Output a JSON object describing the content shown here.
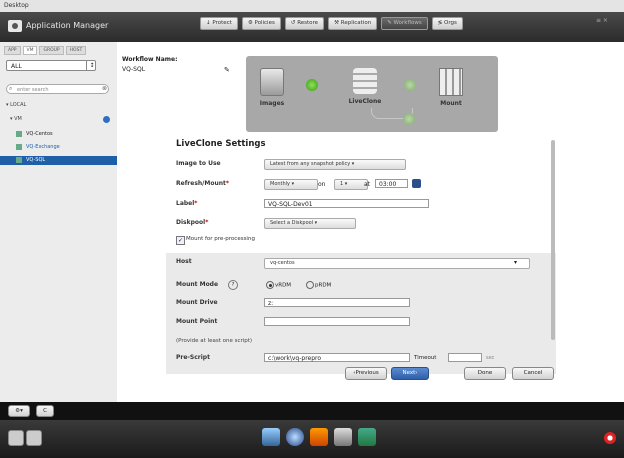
{
  "desktop": {
    "title": "Desktop"
  },
  "app": {
    "title": "Application Manager"
  },
  "topnav": [
    {
      "label": "↓ Protect",
      "active": false
    },
    {
      "label": "⚙ Policies",
      "active": false
    },
    {
      "label": "↺ Restore",
      "active": false
    },
    {
      "label": "⚒ Replication",
      "active": false
    },
    {
      "label": "✎ Workflows",
      "active": true
    },
    {
      "label": "≶ Orgs",
      "active": false
    }
  ],
  "window_controls": "≡ ×",
  "sidebar": {
    "tabs": [
      "APP",
      "VM",
      "GROUP",
      "HOST"
    ],
    "filter_value": "ALL",
    "filter_arrow": "↕",
    "search_placeholder": "enter search",
    "search_icon": "⌕",
    "search_clear": "⊗",
    "tree_local": "▾ LOCAL",
    "tree_vm": "▾ VM",
    "vms": [
      {
        "label": "VQ-Centos",
        "state": "normal"
      },
      {
        "label": "VQ-Exchange",
        "state": "highlight"
      },
      {
        "label": "VQ-SQL",
        "state": "selected"
      }
    ]
  },
  "workflow": {
    "name_label": "Workflow Name:",
    "name_value": "VQ-SQL",
    "edit_icon": "✎",
    "steps": [
      "Images",
      "LiveClone",
      "Mount"
    ]
  },
  "settings": {
    "title": "LiveClone Settings",
    "image_to_use": {
      "label": "Image to Use",
      "value": "Latest from any snapshot policy ▾"
    },
    "refresh": {
      "label": "Refresh/Mount",
      "required": "*",
      "frequency": "Monthly ▾",
      "on_label": "on",
      "day": "1 ▾",
      "at_label": "at",
      "time": "03:00"
    },
    "label_field": {
      "label": "Label",
      "required": "*",
      "value": "VQ-SQL-Dev01"
    },
    "diskpool": {
      "label": "Diskpool",
      "required": "*",
      "value": "Select a Diskpool ▾"
    },
    "mount_checkbox": {
      "label": "Mount for pre-processing",
      "checked": true,
      "mark": "✓"
    },
    "host": {
      "label": "Host",
      "value": "vq-centos",
      "arrow": "▾"
    },
    "mount_mode": {
      "label": "Mount Mode",
      "help": "?",
      "options": [
        "vRDM",
        "pRDM"
      ],
      "selected": "vRDM"
    },
    "mount_drive": {
      "label": "Mount Drive",
      "value": "z:"
    },
    "mount_point": {
      "label": "Mount Point",
      "value": ""
    },
    "script_hint": "(Provide at least one script)",
    "pre_script": {
      "label": "Pre-Script",
      "value": "c:\\work\\vq-prepro",
      "timeout_label": "Timeout",
      "timeout_value": "",
      "unit": "sec"
    }
  },
  "buttons": {
    "previous": "‹Previous",
    "next": "Next›",
    "done": "Done",
    "cancel": "Cancel"
  },
  "bottombar": {
    "btn1": "⚙▾",
    "btn2": "C"
  },
  "colors": {
    "accent": "#1f5fa8",
    "required": "#cc0000",
    "panel_gray": "#a8a8a8"
  }
}
